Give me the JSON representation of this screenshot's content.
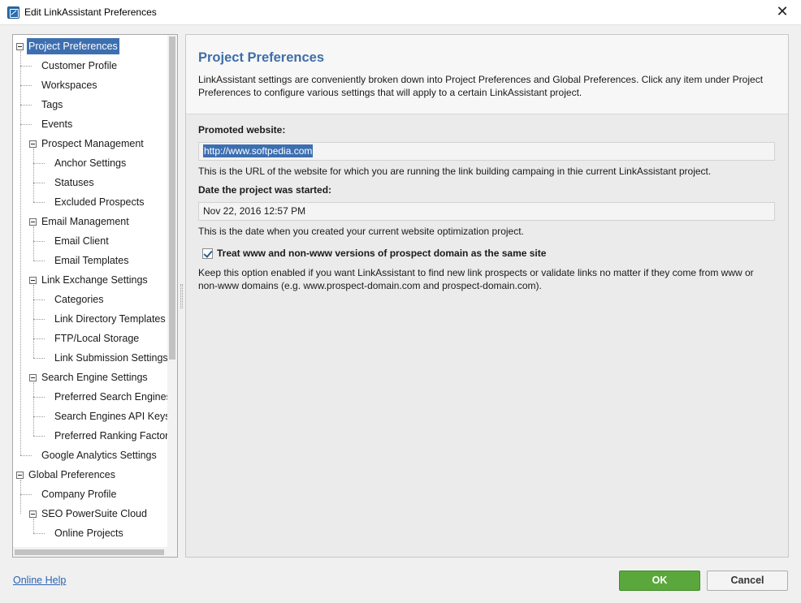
{
  "window": {
    "title": "Edit LinkAssistant Preferences",
    "close_glyph": "✕"
  },
  "tree": {
    "items": [
      {
        "label": "Project Preferences",
        "level": 0,
        "expanded": true,
        "selected": true
      },
      {
        "label": "Customer Profile",
        "level": 1
      },
      {
        "label": "Workspaces",
        "level": 1
      },
      {
        "label": "Tags",
        "level": 1
      },
      {
        "label": "Events",
        "level": 1
      },
      {
        "label": "Prospect Management",
        "level": 1,
        "expanded": true
      },
      {
        "label": "Anchor Settings",
        "level": 2
      },
      {
        "label": "Statuses",
        "level": 2
      },
      {
        "label": "Excluded Prospects",
        "level": 2
      },
      {
        "label": "Email Management",
        "level": 1,
        "expanded": true
      },
      {
        "label": "Email Client",
        "level": 2
      },
      {
        "label": "Email Templates",
        "level": 2
      },
      {
        "label": "Link Exchange Settings",
        "level": 1,
        "expanded": true
      },
      {
        "label": "Categories",
        "level": 2
      },
      {
        "label": "Link Directory Templates",
        "level": 2
      },
      {
        "label": "FTP/Local Storage",
        "level": 2
      },
      {
        "label": "Link Submission Settings",
        "level": 2
      },
      {
        "label": "Search Engine Settings",
        "level": 1,
        "expanded": true
      },
      {
        "label": "Preferred Search Engines",
        "level": 2
      },
      {
        "label": "Search Engines API Keys",
        "level": 2
      },
      {
        "label": "Preferred Ranking Factors",
        "level": 2
      },
      {
        "label": "Google Analytics Settings",
        "level": 1
      },
      {
        "label": "Global Preferences",
        "level": 0,
        "expanded": true
      },
      {
        "label": "Company Profile",
        "level": 1
      },
      {
        "label": "SEO PowerSuite Cloud",
        "level": 1,
        "expanded": true
      },
      {
        "label": "Online Projects",
        "level": 2
      }
    ]
  },
  "content": {
    "title": "Project Preferences",
    "description": "LinkAssistant settings are conveniently broken down into Project Preferences and Global Preferences. Click any item under Project Preferences to configure various settings that will apply to a certain LinkAssistant project.",
    "promoted_website": {
      "label": "Promoted website:",
      "value": "http://www.softpedia.com",
      "hint": "This is the URL of the website for which you are running the link building campaing in thie current LinkAssistant project."
    },
    "date_started": {
      "label": "Date the project was started:",
      "value": "Nov 22, 2016 12:57 PM",
      "hint": "This is the date when you created your current website optimization project."
    },
    "www_option": {
      "label": "Treat www and non-www versions of prospect domain as the same site",
      "checked": true,
      "hint_line1": "Keep this option enabled if you want LinkAssistant to find new link prospects or validate links no matter if they come from www or",
      "hint_line2": "non-www domains (e.g. www.prospect-domain.com and prospect-domain.com)."
    }
  },
  "footer": {
    "help_link": "Online Help",
    "ok_label": "OK",
    "cancel_label": "Cancel"
  },
  "colors": {
    "accent": "#3e6ea8",
    "selection": "#3d6fb0",
    "ok_button": "#5aa83c",
    "link": "#2d63b3"
  }
}
